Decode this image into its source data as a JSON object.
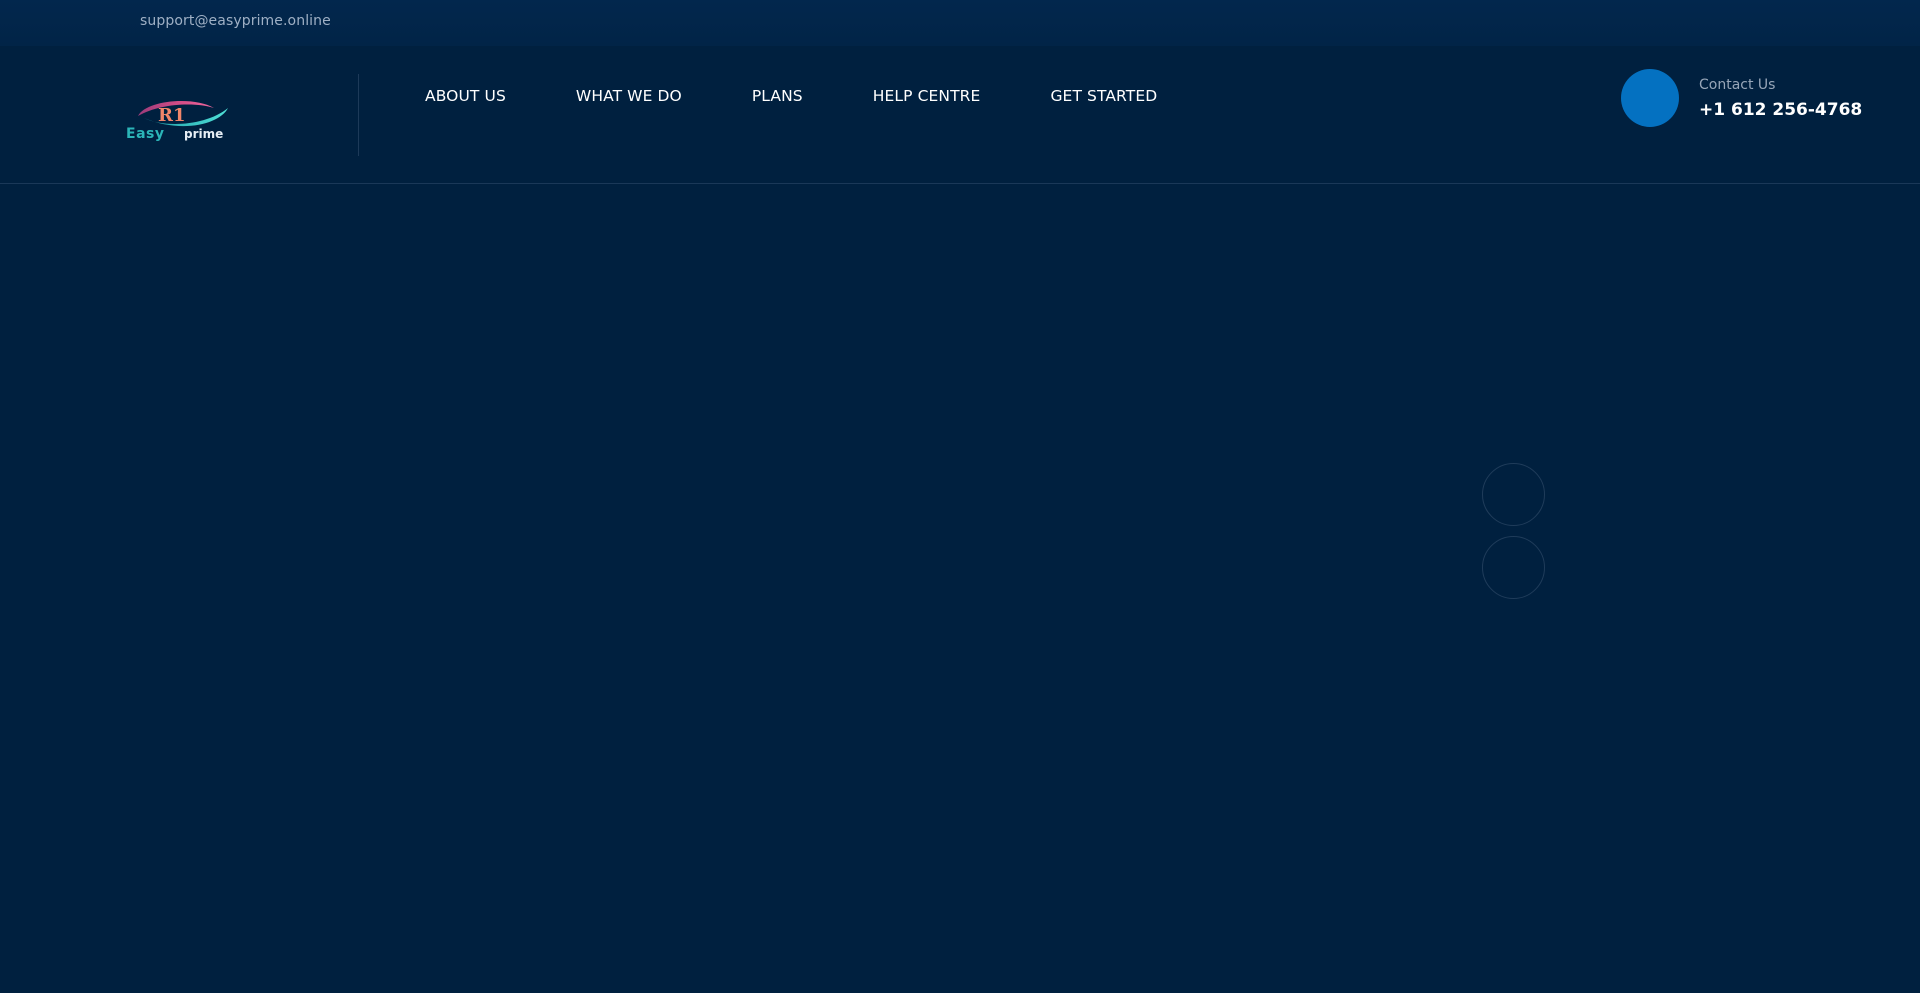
{
  "topbar": {
    "email": "support@easyprime.online"
  },
  "header": {
    "logo": {
      "mark_text": "R1",
      "brand_word_1": "Easy",
      "brand_word_2": "prime"
    },
    "nav": {
      "items": [
        {
          "label": "ABOUT US"
        },
        {
          "label": "WHAT WE DO"
        },
        {
          "label": "PLANS"
        },
        {
          "label": "HELP CENTRE"
        },
        {
          "label": "GET STARTED"
        }
      ]
    },
    "contact": {
      "label": "Contact Us",
      "phone": "+1 612 256-4768",
      "icon": "phone-icon"
    }
  },
  "hero": {
    "slider_controls": [
      "slider-prev-button",
      "slider-next-button"
    ]
  },
  "colors": {
    "background": "#00203f",
    "topbar": "#02274d",
    "accent": "#0471c1",
    "nav_text": "#ffffff",
    "muted_text": "#9fb0c5"
  }
}
